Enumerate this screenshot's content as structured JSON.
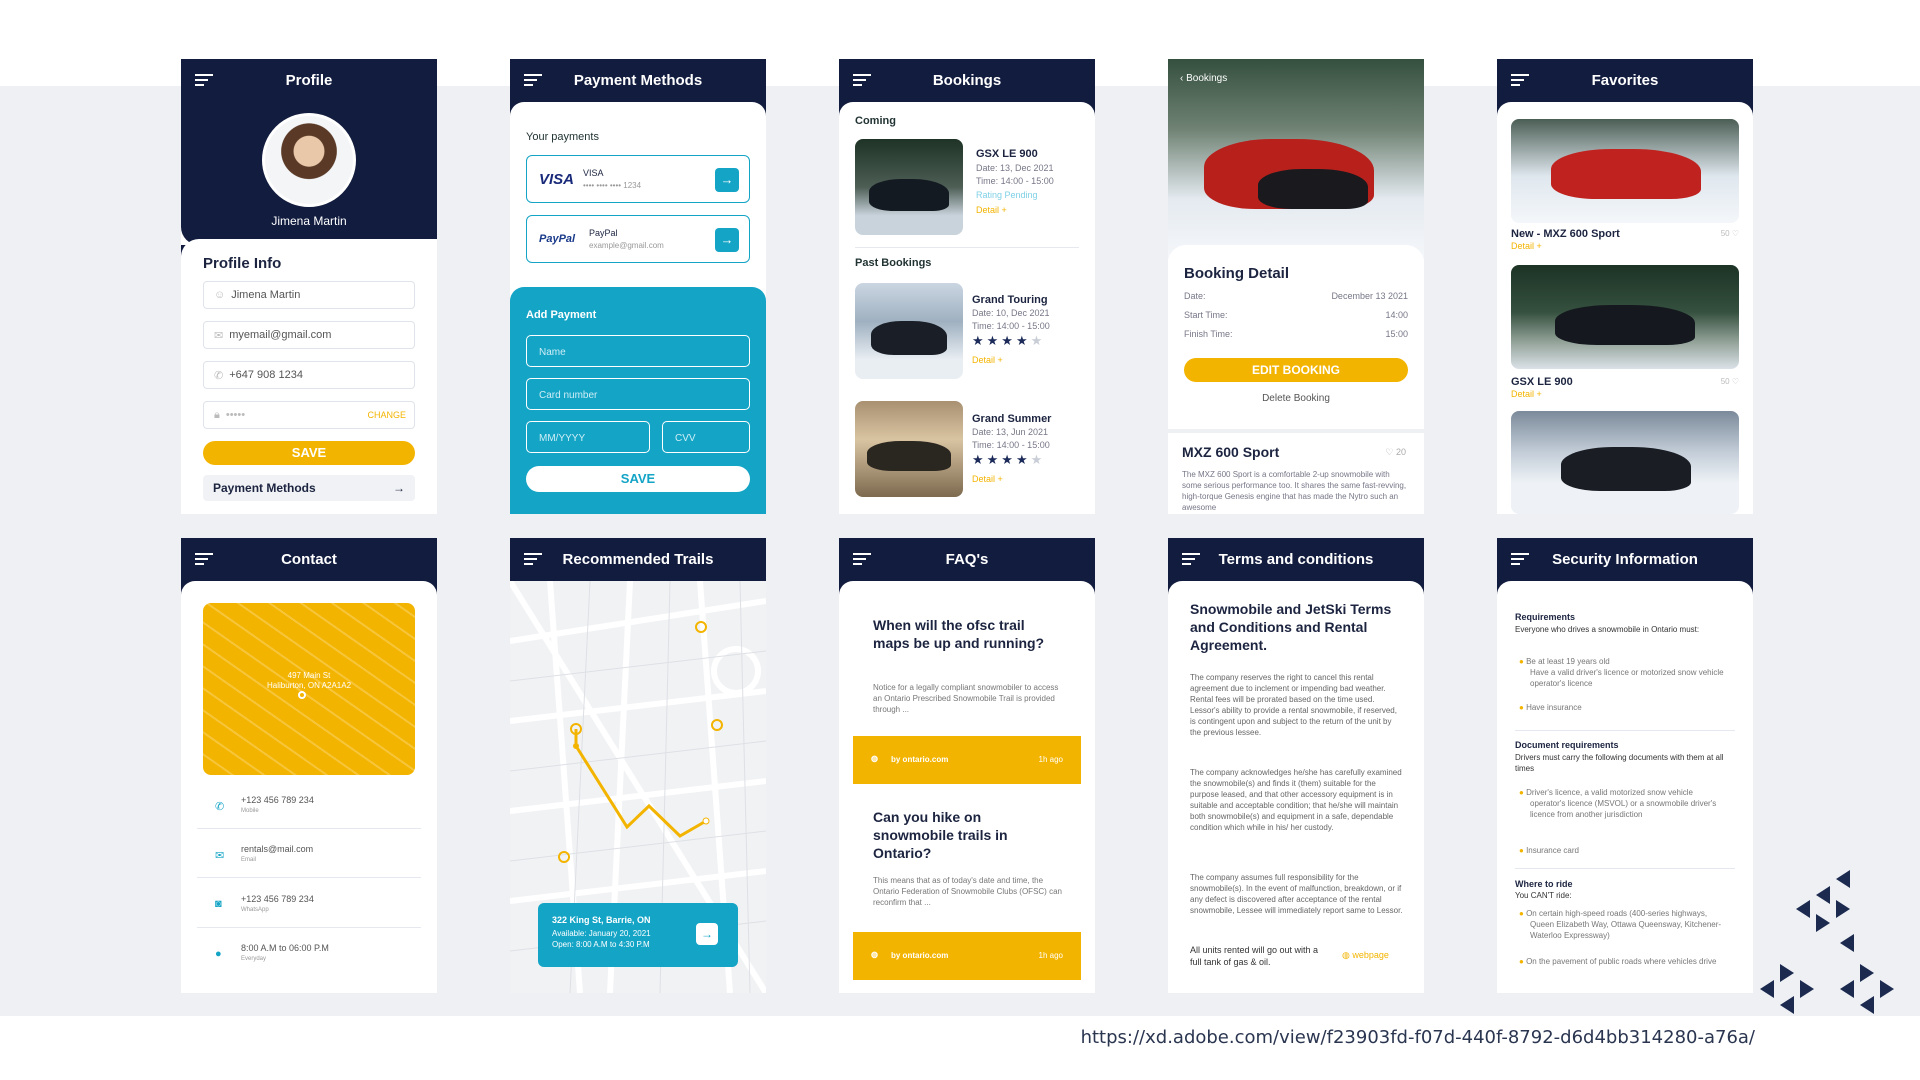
{
  "footer_url": "https://xd.adobe.com/view/f23903fd-f07d-440f-8792-d6d4bb314280-a76a/",
  "colors": {
    "navy": "#121c3f",
    "yellow": "#f3b400",
    "teal": "#14a4c6"
  },
  "profile": {
    "title": "Profile",
    "name": "Jimena Martin",
    "section": "Profile Info",
    "name_field": "Jimena Martin",
    "email_field": "myemail@gmail.com",
    "phone_field": "+647 908 1234",
    "password_field": "•••••",
    "change": "CHANGE",
    "save": "SAVE",
    "payment_link": "Payment Methods"
  },
  "payment": {
    "title": "Payment Methods",
    "your": "Your payments",
    "visa_logo": "VISA",
    "visa_label": "VISA",
    "visa_num": "•••• •••• •••• 1234",
    "paypal_logo": "PayPal",
    "paypal_label": "PayPal",
    "paypal_email": "example@gmail.com",
    "add": "Add Payment",
    "name_ph": "Name",
    "card_ph": "Card number",
    "mm_ph": "MM/YYYY",
    "cvv_ph": "CVV",
    "save": "SAVE"
  },
  "bookings": {
    "title": "Bookings",
    "coming": "Coming",
    "past": "Past Bookings",
    "c1": {
      "name": "GSX LE 900",
      "date": "Date: 13, Dec 2021",
      "time": "Time: 14:00 - 15:00",
      "status": "Rating Pending",
      "detail": "Detail +"
    },
    "p1": {
      "name": "Grand Touring",
      "date": "Date: 10, Dec 2021",
      "time": "Time: 14:00 - 15:00",
      "rating": 4,
      "detail": "Detail +"
    },
    "p2": {
      "name": "Grand Summer",
      "date": "Date: 13, Jun 2021",
      "time": "Time: 14:00 - 15:00",
      "rating": 4,
      "detail": "Detail +"
    }
  },
  "detail": {
    "back": "Bookings",
    "title": "Booking Detail",
    "date_l": "Date:",
    "date_v": "December 13 2021",
    "start_l": "Start Time:",
    "start_v": "14:00",
    "finish_l": "Finish Time:",
    "finish_v": "15:00",
    "edit": "EDIT BOOKING",
    "delete": "Delete Booking",
    "model": "MXZ 600 Sport",
    "likes": "20",
    "desc": "The MXZ 600 Sport is a comfortable 2-up snowmobile with some serious performance too. It shares the same fast-revving, high-torque Genesis engine that has made the Nytro such an awesome"
  },
  "favorites": {
    "title": "Favorites",
    "f1": {
      "name": "New - MXZ 600 Sport",
      "likes": "50",
      "detail": "Detail +"
    },
    "f2": {
      "name": "GSX LE 900",
      "likes": "50",
      "detail": "Detail +"
    }
  },
  "contact": {
    "title": "Contact",
    "addr1": "497 Main St",
    "addr2": "Haliburton, ON A2A1A2",
    "phone": "+123 456 789 234",
    "phone_sub": "Mobile",
    "email": "rentals@mail.com",
    "email_sub": "Email",
    "wa": "+123 456 789 234",
    "wa_sub": "WhatsApp",
    "hours": "8:00 A.M to 06:00 P.M",
    "hours_sub": "Everyday"
  },
  "trails": {
    "title": "Recommended Trails",
    "addr": "322 King St, Barrie, ON",
    "avail": "Available: January 20, 2021",
    "open": "Open: 8:00 A.M to 4:30 P.M"
  },
  "faq": {
    "title": "FAQ's",
    "q1": "When will the ofsc trail maps be up and running?",
    "a1": "Notice for a legally compliant snowmobiler to access an Ontario Prescribed Snowmobile Trail is provided through ...",
    "src1": "by ontario.com",
    "t1": "1h ago",
    "q2": "Can you hike on snowmobile trails in Ontario?",
    "a2": "This means that as of today's date and time, the Ontario Federation of Snowmobile Clubs (OFSC) can reconfirm that ...",
    "src2": "by ontario.com",
    "t2": "1h ago"
  },
  "terms": {
    "title": "Terms and conditions",
    "heading": "Snowmobile and JetSki Terms and Conditions and Rental Agreement.",
    "p1": "The company reserves the right to cancel this rental agreement due to inclement or impending bad weather. Rental fees will be prorated based on the time used. Lessor's ability to provide a rental snowmobile, if reserved, is contingent upon and subject to the return of the unit by the previous lessee.",
    "p2": "The company acknowledges he/she has carefully examined the snowmobile(s) and finds it (them) suitable for the purpose leased, and that other accessory equipment is in suitable and acceptable condition; that he/she will maintain both snowmobile(s) and equipment in a safe, dependable condition which while in his/ her custody.",
    "p3": "The company assumes full responsibility for the snowmobile(s). In the event of malfunction, breakdown, or if any defect is discovered after acceptance of the rental snowmobile, Lessee will immediately report same to Lessor.",
    "foot": "All units rented will go out with a full tank of gas & oil.",
    "web": "webpage"
  },
  "security": {
    "title": "Security Information",
    "req_h": "Requirements",
    "req_s": "Everyone who drives a snowmobile in Ontario must:",
    "r1": "Be at least 19 years old",
    "r1b": "Have a valid driver's licence or motorized snow  vehicle operator's licence",
    "r2": "Have insurance",
    "doc_h": "Document requirements",
    "doc_s": "Drivers must carry the following documents with them at all times",
    "d1": "Driver's licence, a valid motorized snow vehicle operator's licence (MSVOL) or a snowmobile driver's licence from another jurisdiction",
    "d2": "Insurance card",
    "ride_h": "Where to ride",
    "ride_s": "You CAN'T ride:",
    "w1": "On certain high-speed roads (400-series highways, Queen Elizabeth Way, Ottawa Queensway, Kitchener-Waterloo Expressway)",
    "w2": "On the pavement of public roads where vehicles drive"
  }
}
